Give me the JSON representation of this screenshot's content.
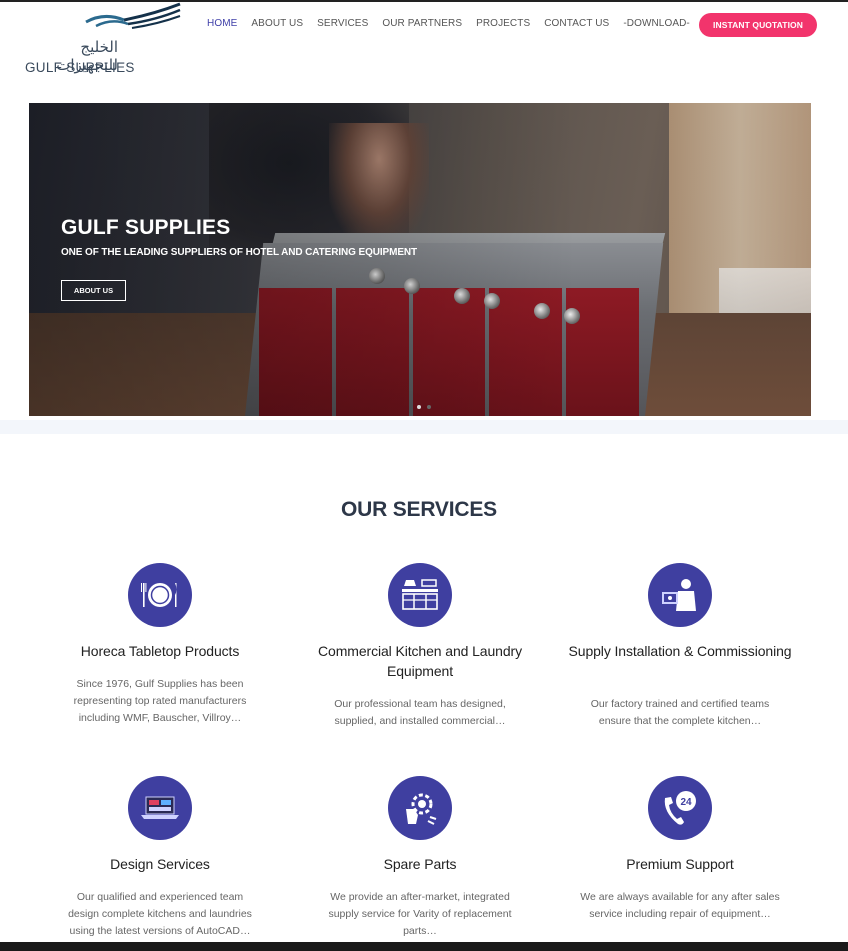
{
  "brand": {
    "arabic": "الخليج للتجهيزات",
    "english": "GULF SUPPLIES"
  },
  "nav": {
    "items": [
      "HOME",
      "ABOUT US",
      "SERVICES",
      "OUR PARTNERS",
      "PROJECTS",
      "CONTACT US",
      "-DOWNLOAD-"
    ],
    "active": "HOME"
  },
  "header": {
    "quote_label": "INSTANT QUOTATION"
  },
  "hero": {
    "title": "GULF SUPPLIES",
    "subtitle": "ONE OF THE LEADING SUPPLIERS OF HOTEL AND CATERING EQUIPMENT",
    "button_label": "ABOUT US"
  },
  "services": {
    "heading": "OUR SERVICES",
    "items": [
      {
        "icon": "tableware-icon",
        "title": "Horeca Tabletop Products",
        "desc": "Since 1976, Gulf Supplies has been representing top rated manufacturers including WMF, Bauscher, Villroy…"
      },
      {
        "icon": "kitchen-icon",
        "title": "Commercial Kitchen and Laundry Equipment",
        "desc": "Our professional team has designed, supplied, and installed commercial…"
      },
      {
        "icon": "installation-icon",
        "title": "Supply Installation & Commissioning",
        "desc": "Our factory trained and certified teams ensure that the complete kitchen…"
      },
      {
        "icon": "laptop-design-icon",
        "title": "Design Services",
        "desc": "Our qualified and experienced team design complete kitchens and laundries using the latest versions of AutoCAD…"
      },
      {
        "icon": "gear-hand-icon",
        "title": "Spare Parts",
        "desc": "We provide an after-market, integrated supply service for Varity of replacement parts…"
      },
      {
        "icon": "phone-24-icon",
        "title": "Premium Support",
        "desc": "We are always available for any after sales service including repair of equipment…"
      }
    ]
  },
  "colors": {
    "accent": "#3f3fa0",
    "cta": "#f2346c",
    "heading": "#2d3748"
  }
}
